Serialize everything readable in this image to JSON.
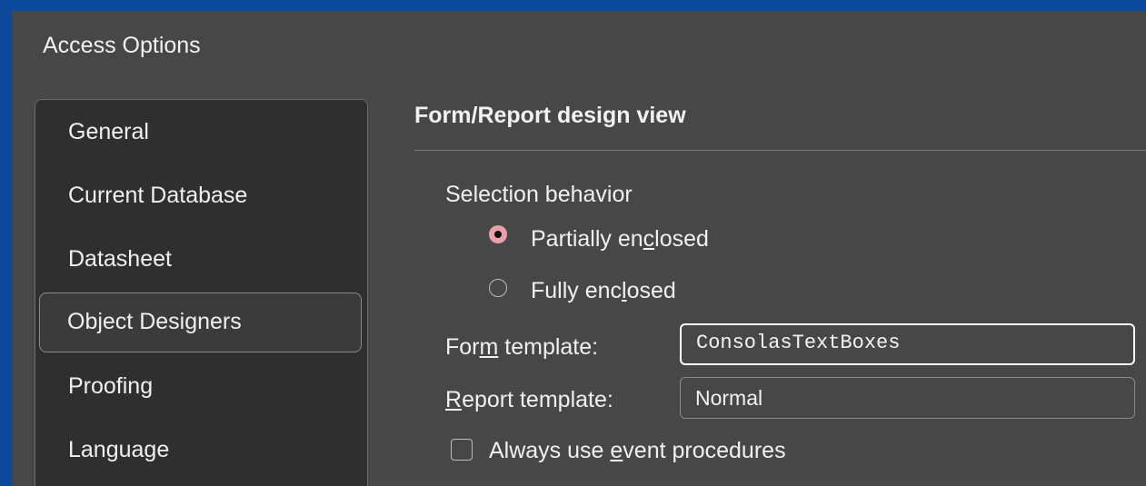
{
  "window": {
    "title": "Access Options"
  },
  "nav": {
    "items": [
      {
        "label": "General"
      },
      {
        "label": "Current Database"
      },
      {
        "label": "Datasheet"
      },
      {
        "label": "Object Designers"
      },
      {
        "label": "Proofing"
      },
      {
        "label": "Language"
      }
    ],
    "selected": "Object Designers"
  },
  "section": {
    "title": "Form/Report design view",
    "selection_behavior": {
      "label": "Selection behavior",
      "options": [
        {
          "label_pre": "Partially en",
          "label_u": "c",
          "label_post": "losed",
          "selected": true
        },
        {
          "label_pre": "Fully enc",
          "label_u": "l",
          "label_post": "osed",
          "selected": false
        }
      ]
    },
    "form_template": {
      "label_pre": "For",
      "label_u": "m",
      "label_post": " template:",
      "value": "ConsolasTextBoxes"
    },
    "report_template": {
      "label_pre": "",
      "label_u": "R",
      "label_post": "eport template:",
      "value": "Normal"
    },
    "always_event": {
      "label_pre": "Always use ",
      "label_u": "e",
      "label_post": "vent procedures",
      "checked": false
    }
  },
  "colors": {
    "accent_radio": "#e9a0a8",
    "background": "#474747",
    "frame": "#0b4a9a"
  }
}
